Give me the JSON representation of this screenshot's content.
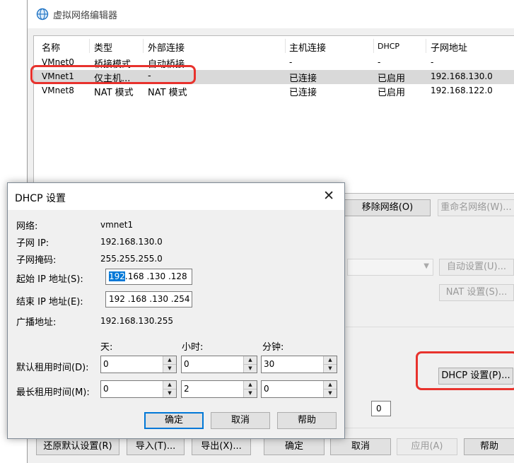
{
  "window": {
    "title": "虚拟网络编辑器"
  },
  "table": {
    "columns": [
      "名称",
      "类型",
      "外部连接",
      "主机连接",
      "DHCP",
      "子网地址"
    ],
    "rows": [
      {
        "name": "VMnet0",
        "type": "桥接模式",
        "external": "自动桥接",
        "host": "-",
        "dhcp": "-",
        "subnet": "-"
      },
      {
        "name": "VMnet1",
        "type": "仅主机...",
        "external": "-",
        "host": "已连接",
        "dhcp": "已启用",
        "subnet": "192.168.130.0"
      },
      {
        "name": "VMnet8",
        "type": "NAT 模式",
        "external": "NAT 模式",
        "host": "已连接",
        "dhcp": "已启用",
        "subnet": "192.168.122.0"
      }
    ]
  },
  "main_buttons": {
    "remove_network": "移除网络(O)",
    "rename_network": "重命名网络(W)...",
    "auto_settings": "自动设置(U)...",
    "nat_settings": "NAT 设置(S)...",
    "dhcp_settings": "DHCP 设置(P)...",
    "restore_defaults": "还原默认设置(R)",
    "import": "导入(T)...",
    "export": "导出(X)...",
    "ok": "确定",
    "cancel": "取消",
    "apply": "应用(A)",
    "help": "帮助"
  },
  "main_small_input": "0",
  "dialog": {
    "title": "DHCP 设置",
    "network_label": "网络:",
    "network_value": "vmnet1",
    "subnet_ip_label": "子网 IP:",
    "subnet_ip_value": "192.168.130.0",
    "subnet_mask_label": "子网掩码:",
    "subnet_mask_value": "255.255.255.0",
    "start_ip_label": "起始 IP 地址(S):",
    "start_ip_selected": "192",
    "start_ip_rest": ".168 .130 .128",
    "end_ip_label": "结束 IP 地址(E):",
    "end_ip_value": "192 .168 .130 .254",
    "broadcast_label": "广播地址:",
    "broadcast_value": "192.168.130.255",
    "days_label": "天:",
    "hours_label": "小时:",
    "minutes_label": "分钟:",
    "default_lease_label": "默认租用时间(D):",
    "max_lease_label": "最长租用时间(M):",
    "default_lease": {
      "days": "0",
      "hours": "0",
      "minutes": "30"
    },
    "max_lease": {
      "days": "0",
      "hours": "2",
      "minutes": "0"
    },
    "ok": "确定",
    "cancel": "取消",
    "help": "帮助"
  },
  "colors": {
    "annotation": "#e8322d",
    "selection": "#0078d7",
    "selected_row": "#d9d9d9"
  },
  "icons": [
    "network-globe-icon",
    "close-icon",
    "chevron-down-icon",
    "spin-up-icon",
    "spin-down-icon"
  ]
}
